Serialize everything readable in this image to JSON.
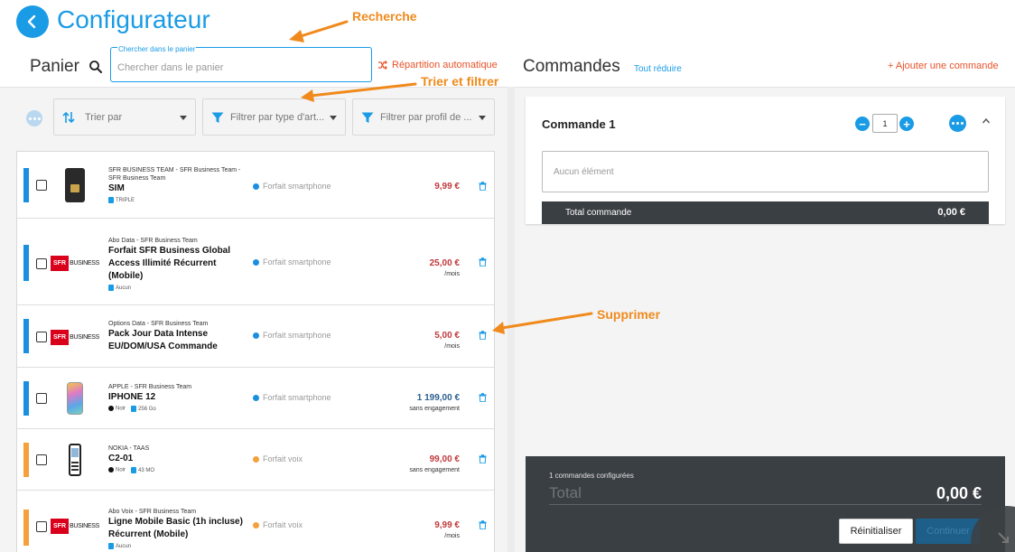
{
  "header": {
    "title": "Configurateur",
    "panier_label": "Panier",
    "commandes_label": "Commandes",
    "tout_reduire": "Tout réduire",
    "add_command": "+ Ajouter une commande",
    "auto_split": "Répartition automatique"
  },
  "search": {
    "floating_label": "Chercher dans le panier",
    "placeholder": "Chercher dans le panier"
  },
  "filters": {
    "sort": "Trier par",
    "type": "Filtrer par type d'art...",
    "profile": "Filtrer par profil de ..."
  },
  "items": [
    {
      "supplier": "SFR BUSINESS TEAM - SFR Business Team - SFR Business Team",
      "name": "SIM",
      "tag1": "TRIPLE",
      "tag2": "",
      "category": "Forfait smartphone",
      "price": "9,99 €",
      "price_sub": "",
      "bar_color": "#1a8fe0",
      "category_color": "#1a8fe0"
    },
    {
      "supplier": "Abo Data - SFR Business Team",
      "name": "Forfait SFR Business Global Access Illimité Récurrent (Mobile)",
      "tag1": "Aucun",
      "tag2": "",
      "category": "Forfait smartphone",
      "price": "25,00 €",
      "price_sub": "/mois",
      "bar_color": "#1a8fe0",
      "category_color": "#1a8fe0"
    },
    {
      "supplier": "Options Data - SFR Business Team",
      "name": "Pack Jour Data Intense EU/DOM/USA Commande",
      "tag1": "",
      "tag2": "",
      "category": "Forfait smartphone",
      "price": "5,00 €",
      "price_sub": "/mois",
      "bar_color": "#1a8fe0",
      "category_color": "#1a8fe0"
    },
    {
      "supplier": "APPLE - SFR Business Team",
      "name": "IPHONE 12",
      "tag1": "Noir",
      "tag2": "256 Go",
      "category": "Forfait smartphone",
      "price": "1 199,00 €",
      "price_sub": "sans engagement",
      "bar_color": "#1a8fe0",
      "category_color": "#1a8fe0"
    },
    {
      "supplier": "NOKIA - TAAS",
      "name": "C2-01",
      "tag1": "Noir",
      "tag2": "43 MO",
      "category": "Forfait voix",
      "price": "99,00 €",
      "price_sub": "sans engagement",
      "bar_color": "#f5a03a",
      "category_color": "#f5a03a"
    },
    {
      "supplier": "Abo Voix - SFR Business Team",
      "name": "Ligne Mobile Basic (1h incluse) Récurrent (Mobile)",
      "tag1": "Aucun",
      "tag2": "",
      "category": "Forfait voix",
      "price": "9,99 €",
      "price_sub": "/mois",
      "bar_color": "#f5a03a",
      "category_color": "#f5a03a"
    }
  ],
  "sfr_logo": {
    "box": "SFR",
    "text": "BUSINESS"
  },
  "command": {
    "title": "Commande 1",
    "quantity": "1",
    "empty": "Aucun élément",
    "total_label": "Total commande",
    "total_value": "0,00 €"
  },
  "summary": {
    "count": "1 commandes configurées",
    "label": "Total",
    "value": "0,00 €",
    "reset": "Réinitialiser",
    "continue": "Continuer"
  },
  "annotations": {
    "recherche": "Recherche",
    "trier": "Trier et filtrer",
    "supprimer": "Supprimer"
  },
  "colors": {
    "primary": "#1a9be6",
    "accent": "#e8532a",
    "annotation": "#f08a1c",
    "price": "#c0393b",
    "dark": "#3a3f44"
  }
}
